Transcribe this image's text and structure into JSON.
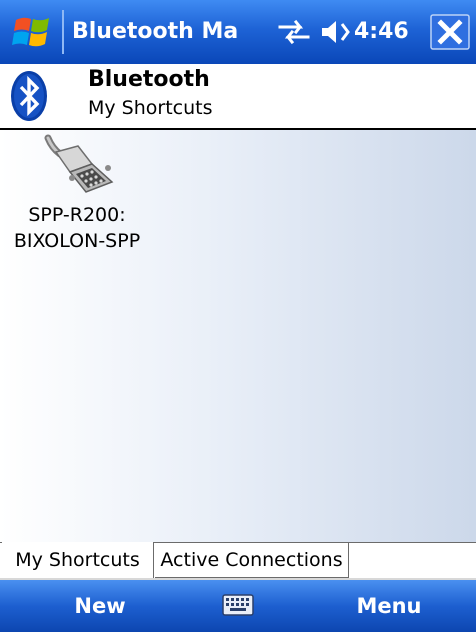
{
  "titlebar": {
    "app_title": "Bluetooth Mana",
    "clock": "4:46",
    "icons": {
      "start": "windows-flag-icon",
      "connectivity": "connectivity-icon",
      "volume": "volume-icon",
      "close": "close-icon"
    }
  },
  "header": {
    "title": "Bluetooth",
    "subtitle": "My Shortcuts",
    "icon": "bluetooth-icon"
  },
  "shortcuts": [
    {
      "name": "SPP-R200: BIXOLON-SPP",
      "line1": "SPP-R200:",
      "line2": "BIXOLON-SPP",
      "icon": "serial-port-icon"
    }
  ],
  "tabs": [
    {
      "label": "My Shortcuts",
      "selected": true
    },
    {
      "label": "Active Connections",
      "selected": false
    }
  ],
  "softkeys": {
    "left": "New",
    "right": "Menu",
    "center_icon": "keyboard-icon"
  },
  "colors": {
    "titlebar": "#1e63d6",
    "softkey_bar": "#1d5fd0",
    "close_button": "#2f6fe0"
  }
}
